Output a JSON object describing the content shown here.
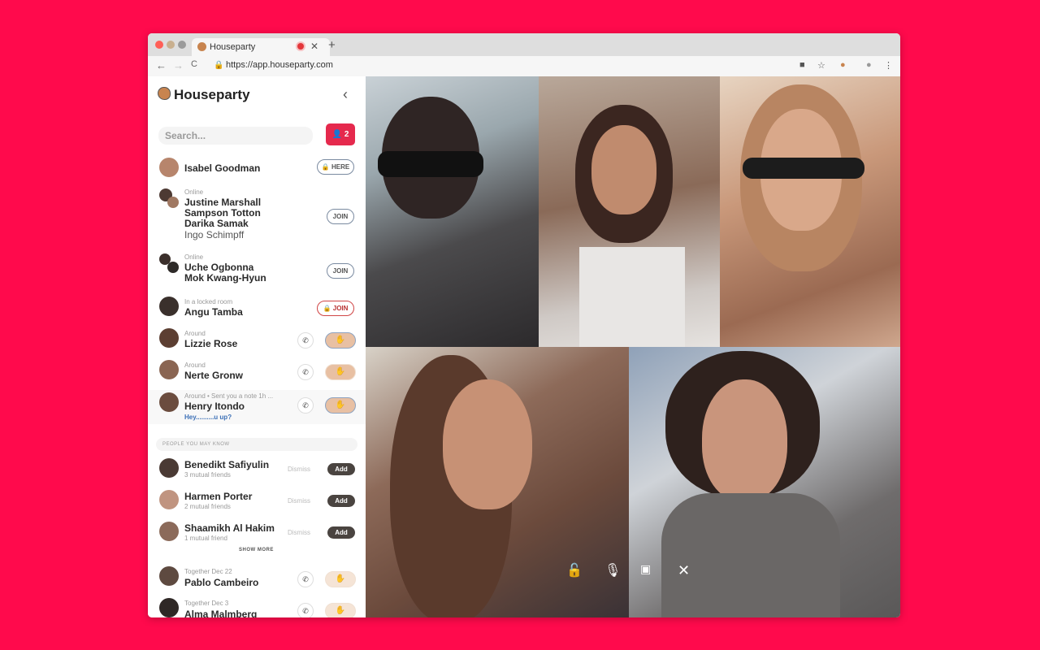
{
  "browser": {
    "tab_title": "Houseparty",
    "tab_close": "✕",
    "new_tab": "+",
    "url": "https://app.houseparty.com",
    "nav_back": "←",
    "nav_forward": "→",
    "nav_reload": "C"
  },
  "sidebar": {
    "brand": "Houseparty",
    "collapse": "‹",
    "search_placeholder": "Search...",
    "friend_requests_count": "2",
    "friends": [
      {
        "name": "Isabel Goodman",
        "action": "HERE"
      },
      {
        "status": "Online",
        "names": [
          "Justine Marshall",
          "Sampson Totton",
          "Darika Samak",
          "Ingo Schimpff"
        ],
        "action": "JOIN"
      },
      {
        "status": "Online",
        "names": [
          "Uche Ogbonna",
          "Mok Kwang-Hyun"
        ],
        "action": "JOIN"
      },
      {
        "status": "In a locked room",
        "name": "Angu Tamba",
        "action": "JOIN"
      },
      {
        "status": "Around",
        "name": "Lizzie Rose"
      },
      {
        "status": "Around",
        "name": "Nerte Gronw"
      },
      {
        "status": "Around • Sent you a note 1h ...",
        "name": "Henry Itondo",
        "note": "Hey..........u up?"
      }
    ],
    "people_you_may_know_label": "PEOPLE YOU MAY KNOW",
    "suggestions": [
      {
        "name": "Benedikt Safiyulin",
        "mutual": "3 mutual friends",
        "dismiss": "Dismiss",
        "add": "Add"
      },
      {
        "name": "Harmen Porter",
        "mutual": "2 mutual friends",
        "dismiss": "Dismiss",
        "add": "Add"
      },
      {
        "name": "Shaamikh Al Hakim",
        "mutual": "1 mutual friend",
        "dismiss": "Dismiss",
        "add": "Add"
      }
    ],
    "show_more": "SHOW MORE",
    "past": [
      {
        "status": "Together Dec 22",
        "name": "Pablo Cambeiro"
      },
      {
        "status": "Together Dec 3",
        "name": "Alma Malmberg"
      }
    ]
  },
  "colors": {
    "background": "#ff0a4c",
    "accent": "#e5294d"
  }
}
